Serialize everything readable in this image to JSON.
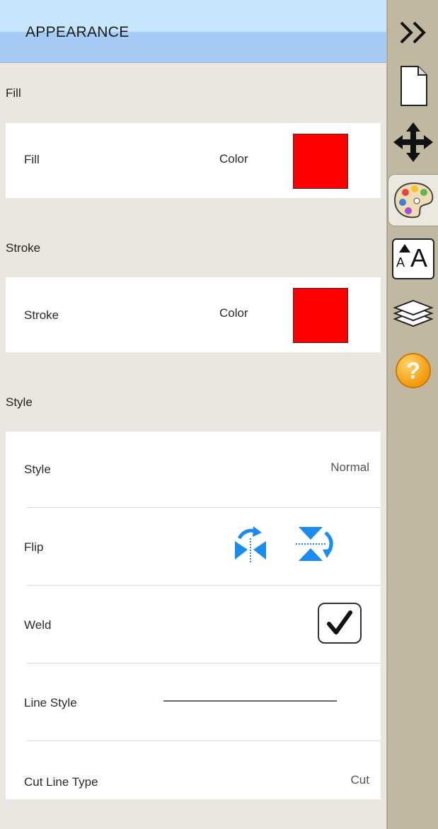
{
  "header": {
    "title": "APPEARANCE"
  },
  "fill_section": {
    "heading": "Fill",
    "row_label": "Fill",
    "value_label": "Color",
    "color": "#ff0000"
  },
  "stroke_section": {
    "heading": "Stroke",
    "row_label": "Stroke",
    "value_label": "Color",
    "color": "#ff0000"
  },
  "style_section": {
    "heading": "Style",
    "style_row": {
      "label": "Style",
      "value": "Normal"
    },
    "flip_row": {
      "label": "Flip"
    },
    "weld_row": {
      "label": "Weld",
      "checked": true
    },
    "line_style_row": {
      "label": "Line Style"
    },
    "cut_line_row": {
      "label": "Cut Line Type",
      "value": "Cut"
    }
  },
  "toolbar": {
    "items": [
      "collapse-icon",
      "document-icon",
      "move-icon",
      "palette-icon",
      "text-size-icon",
      "layers-icon",
      "help-icon"
    ],
    "text_size_glyph": "A",
    "help_glyph": "?"
  }
}
